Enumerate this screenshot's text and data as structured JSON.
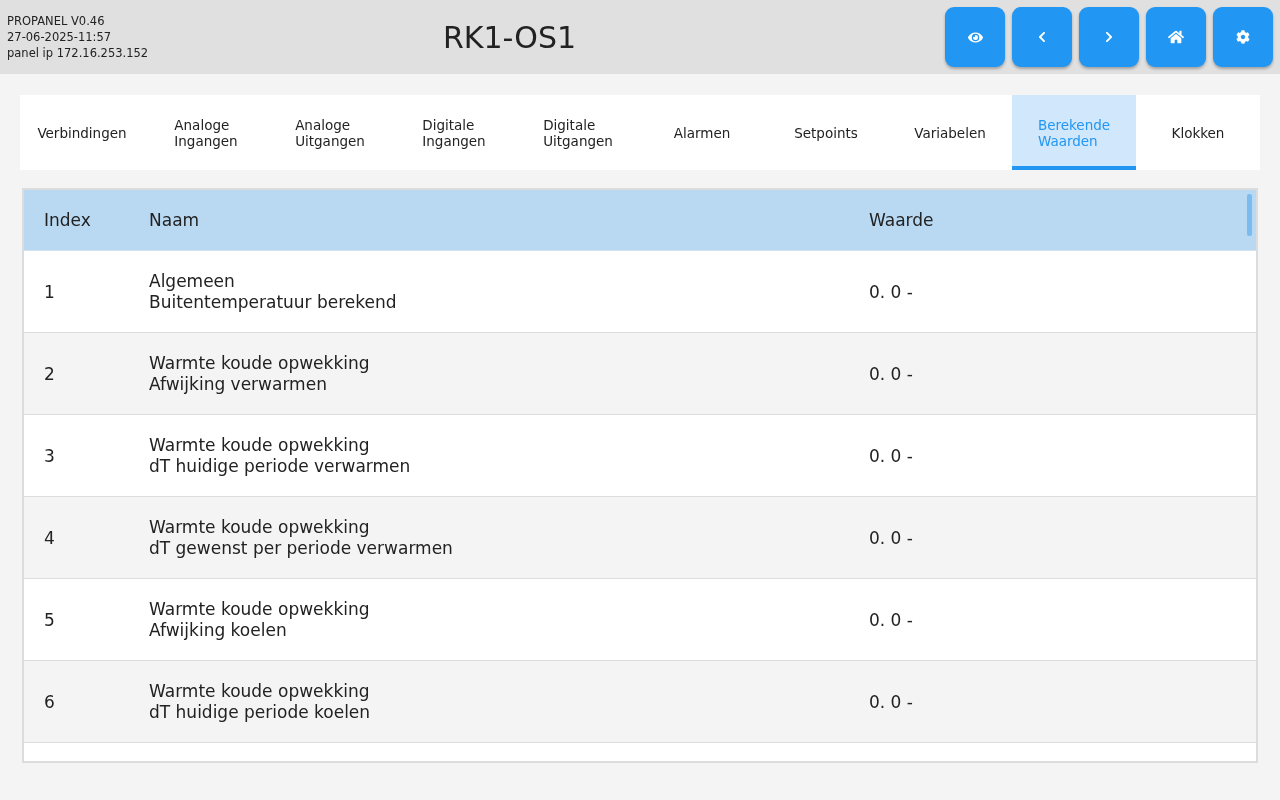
{
  "header": {
    "app_version": "PROPANEL V0.46",
    "timestamp": "27-06-2025-11:57",
    "panel_ip": "panel ip 172.16.253.152",
    "title": "RK1-OS1",
    "buttons": [
      {
        "kind": "view"
      },
      {
        "kind": "back"
      },
      {
        "kind": "forward"
      },
      {
        "kind": "home"
      },
      {
        "kind": "settings"
      }
    ]
  },
  "tabs": [
    {
      "label": "Verbindingen",
      "selected": false
    },
    {
      "label": "Analoge Ingangen",
      "selected": false
    },
    {
      "label": "Analoge Uitgangen",
      "selected": false
    },
    {
      "label": "Digitale Ingangen",
      "selected": false
    },
    {
      "label": "Digitale Uitgangen",
      "selected": false
    },
    {
      "label": "Alarmen",
      "selected": false
    },
    {
      "label": "Setpoints",
      "selected": false
    },
    {
      "label": "Variabelen",
      "selected": false
    },
    {
      "label": "Berekende Waarden",
      "selected": true
    },
    {
      "label": "Klokken",
      "selected": false
    }
  ],
  "table": {
    "columns": [
      "Index",
      "Naam",
      "Waarde"
    ],
    "rows": [
      {
        "index": "1",
        "group": "Algemeen",
        "name": "Buitentemperatuur berekend",
        "value": "0. 0 -"
      },
      {
        "index": "2",
        "group": "Warmte koude opwekking",
        "name": "Afwijking verwarmen",
        "value": "0. 0 -"
      },
      {
        "index": "3",
        "group": "Warmte koude opwekking",
        "name": "dT huidige periode verwarmen",
        "value": "0. 0 -"
      },
      {
        "index": "4",
        "group": "Warmte koude opwekking",
        "name": "dT gewenst per periode verwarmen",
        "value": "0. 0 -"
      },
      {
        "index": "5",
        "group": "Warmte koude opwekking",
        "name": "Afwijking koelen",
        "value": "0. 0 -"
      },
      {
        "index": "6",
        "group": "Warmte koude opwekking",
        "name": "dT huidige periode koelen",
        "value": "0. 0 -"
      }
    ]
  }
}
